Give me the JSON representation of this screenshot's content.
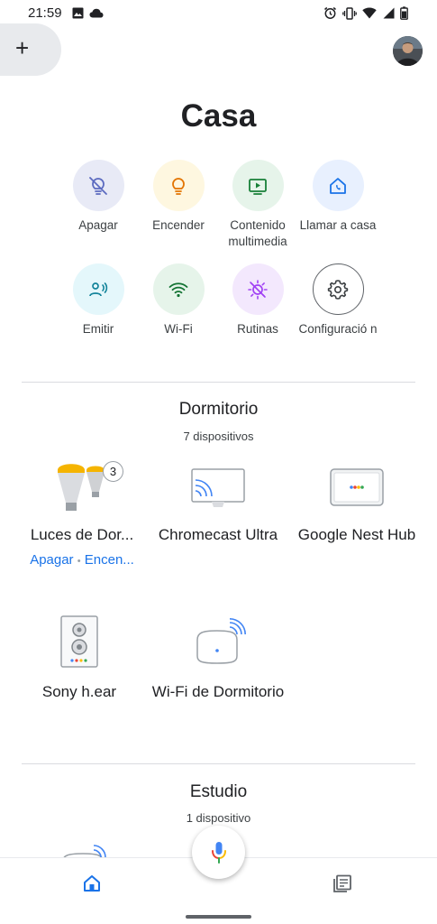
{
  "status_bar": {
    "time": "21:59"
  },
  "header": {
    "add_label": "+",
    "title": "Casa"
  },
  "actions": [
    {
      "label": "Apagar",
      "icon": "light-off-icon",
      "bg": "#e8eaf6",
      "color": "#5c6bc0"
    },
    {
      "label": "Encender",
      "icon": "lightbulb-icon",
      "bg": "#fef7e0",
      "color": "#e37400"
    },
    {
      "label": "Contenido multimedia",
      "icon": "media-play-icon",
      "bg": "#e6f4ea",
      "color": "#188038"
    },
    {
      "label": "Llamar a casa",
      "icon": "home-call-icon",
      "bg": "#e8f0fe",
      "color": "#1a73e8"
    },
    {
      "label": "Emitir",
      "icon": "cast-person-icon",
      "bg": "#e4f7fb",
      "color": "#12839a"
    },
    {
      "label": "Wi-Fi",
      "icon": "wifi-icon",
      "bg": "#e6f4ea",
      "color": "#137333"
    },
    {
      "label": "Rutinas",
      "icon": "routines-icon",
      "bg": "#f3e8fd",
      "color": "#a142f4"
    },
    {
      "label": "Configuració n",
      "icon": "settings-gear-icon",
      "bg": "#ffffff",
      "color": "#3c4043"
    }
  ],
  "rooms": [
    {
      "name": "Dormitorio",
      "count": "7 dispositivos",
      "devices": [
        {
          "label": "Luces de Dor...",
          "icon": "lights-group-icon",
          "badge": "3",
          "action_off": "Apagar",
          "action_sep": "•",
          "action_on": "Encen..."
        },
        {
          "label": "Chromecast Ultra",
          "icon": "chromecast-icon"
        },
        {
          "label": "Google Nest Hub",
          "icon": "nest-hub-icon"
        },
        {
          "label": "Sony h.ear",
          "icon": "speaker-icon"
        },
        {
          "label": "Wi-Fi de Dormitorio",
          "icon": "wifi-point-icon"
        }
      ]
    },
    {
      "name": "Estudio",
      "count": "1 dispositivo"
    }
  ],
  "bottom_nav": {
    "home_icon": "home-icon",
    "feed_icon": "feed-icon",
    "mic_icon": "mic-icon"
  }
}
